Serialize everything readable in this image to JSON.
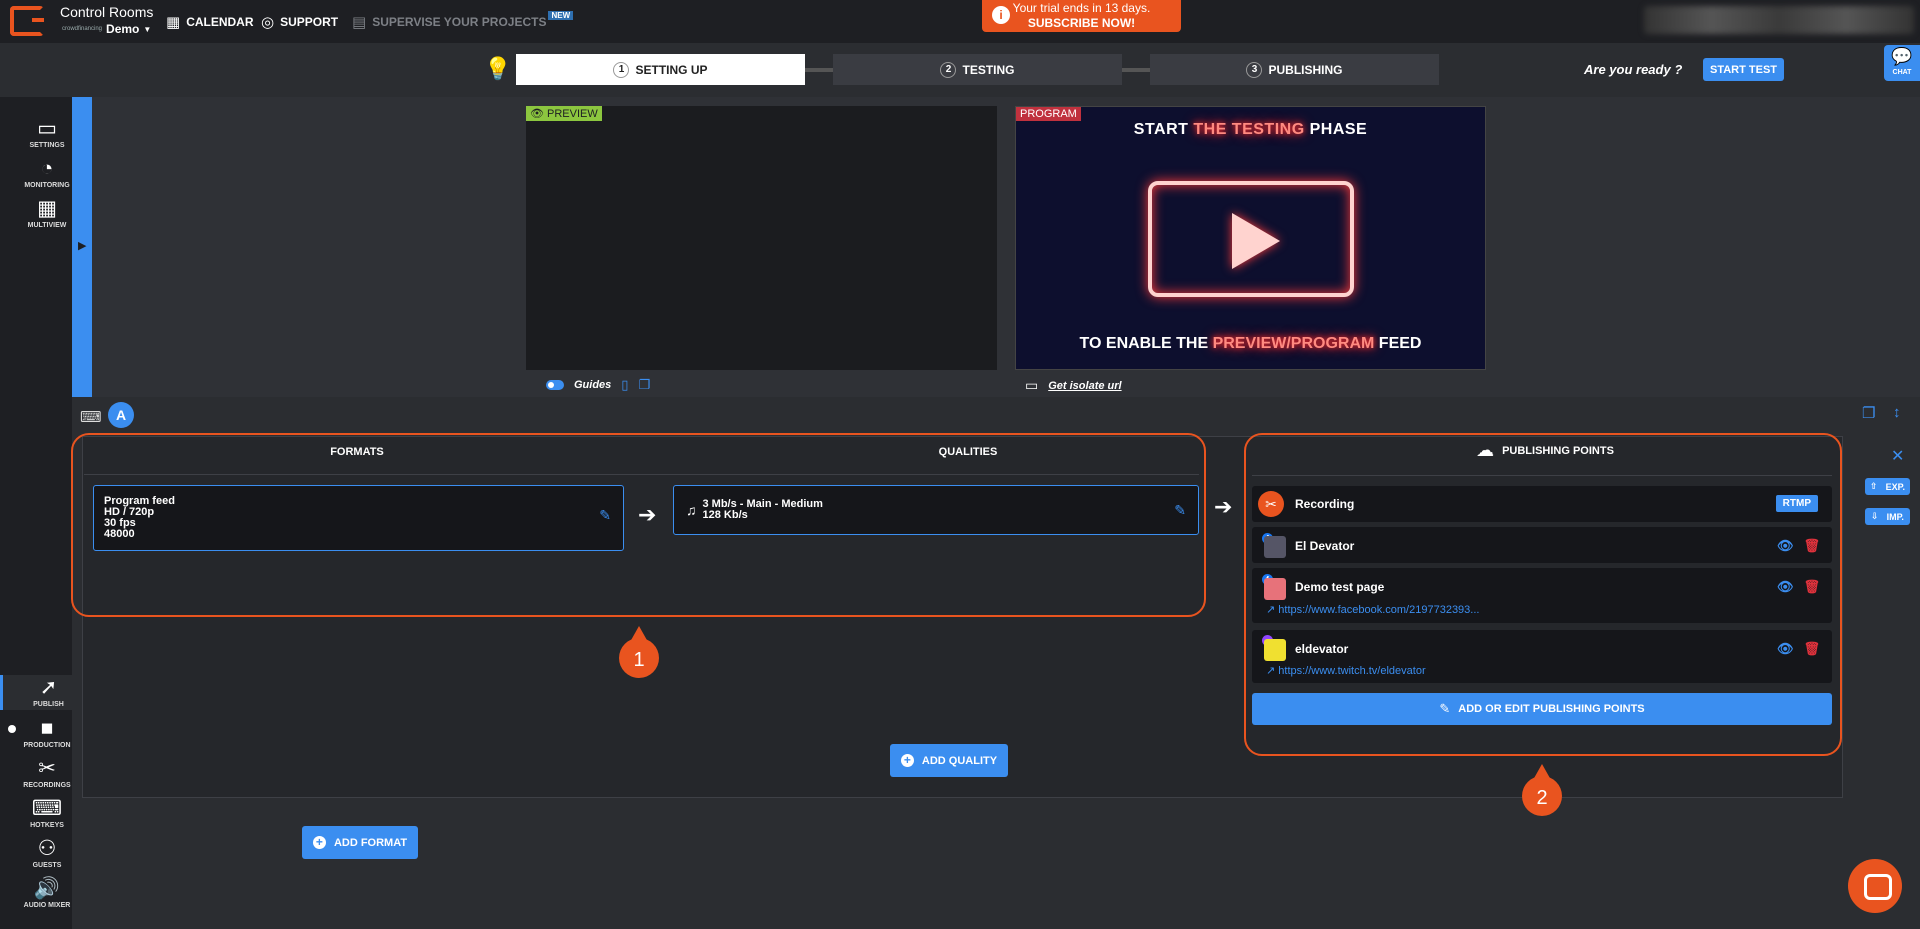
{
  "topbar": {
    "app_title": "Control Rooms",
    "project_name": "Demo",
    "project_logo_text": "crowdfinancing",
    "nav": [
      {
        "label": "CALENDAR",
        "icon": "calendar-icon"
      },
      {
        "label": "SUPPORT",
        "icon": "lifebuoy-icon"
      },
      {
        "label": "SUPERVISE YOUR PROJECTS",
        "icon": "grid-icon",
        "badge": "NEW"
      }
    ],
    "trial": {
      "line1": "Your trial ends in 13 days.",
      "line2": "SUBSCRIBE NOW!"
    }
  },
  "steps": [
    {
      "num": "1",
      "label": "SETTING UP"
    },
    {
      "num": "2",
      "label": "TESTING"
    },
    {
      "num": "3",
      "label": "PUBLISHING"
    }
  ],
  "ready_text": "Are you ready ?",
  "start_test_label": "START TEST",
  "chat_label": "CHAT",
  "sidebar_top": [
    {
      "label": "SETTINGS",
      "icon": "settings-icon"
    },
    {
      "label": "MONITORING",
      "icon": "gauge-icon"
    },
    {
      "label": "MULTIVIEW",
      "icon": "multiview-icon"
    }
  ],
  "sidebar_bottom": [
    {
      "label": "PUBLISH",
      "icon": "publish-icon"
    },
    {
      "label": "PRODUCTION",
      "icon": "camera-icon"
    },
    {
      "label": "RECORDINGS",
      "icon": "scissors-icon"
    },
    {
      "label": "HOTKEYS",
      "icon": "keyboard-icon"
    },
    {
      "label": "GUESTS",
      "icon": "guests-icon"
    },
    {
      "label": "AUDIO MIXER",
      "icon": "speaker-icon"
    }
  ],
  "preview": {
    "preview_tag": "PREVIEW",
    "program_tag": "PROGRAM",
    "program_title_pre": "START ",
    "program_title_glow": "THE TESTING",
    "program_title_post": " PHASE",
    "program_foot_pre": "TO ENABLE THE ",
    "program_foot_glow": "PREVIEW/PROGRAM",
    "program_foot_post": " FEED",
    "guides_label": "Guides",
    "isolate_label": "Get isolate url"
  },
  "avatar_letter": "A",
  "formats_header": "FORMATS",
  "qualities_header": "QUALITIES",
  "format_card": {
    "line1": "Program feed",
    "line2": "HD / 720p",
    "line3": "30 fps",
    "line4": "48000"
  },
  "quality_card": {
    "video": "3 Mb/s  -  Main  -  Medium",
    "audio": "128 Kb/s"
  },
  "add_quality_label": "ADD QUALITY",
  "add_format_label": "ADD FORMAT",
  "callouts": {
    "one": "1",
    "two": "2"
  },
  "publishing": {
    "header": "PUBLISHING POINTS",
    "recording_name": "Recording",
    "recording_badge": "RTMP",
    "points": [
      {
        "name": "El Devator",
        "link": ""
      },
      {
        "name": "Demo test page",
        "link": "https://www.facebook.com/2197732393..."
      },
      {
        "name": "eldevator",
        "link": "https://www.twitch.tv/eldevator"
      }
    ],
    "add_edit_label": "ADD OR EDIT PUBLISHING POINTS"
  },
  "right_buttons": {
    "exp": "EXP.",
    "imp": "IMP."
  },
  "colors": {
    "accent": "#3b8ef0",
    "brand": "#e9541f",
    "danger": "#e0323c"
  }
}
